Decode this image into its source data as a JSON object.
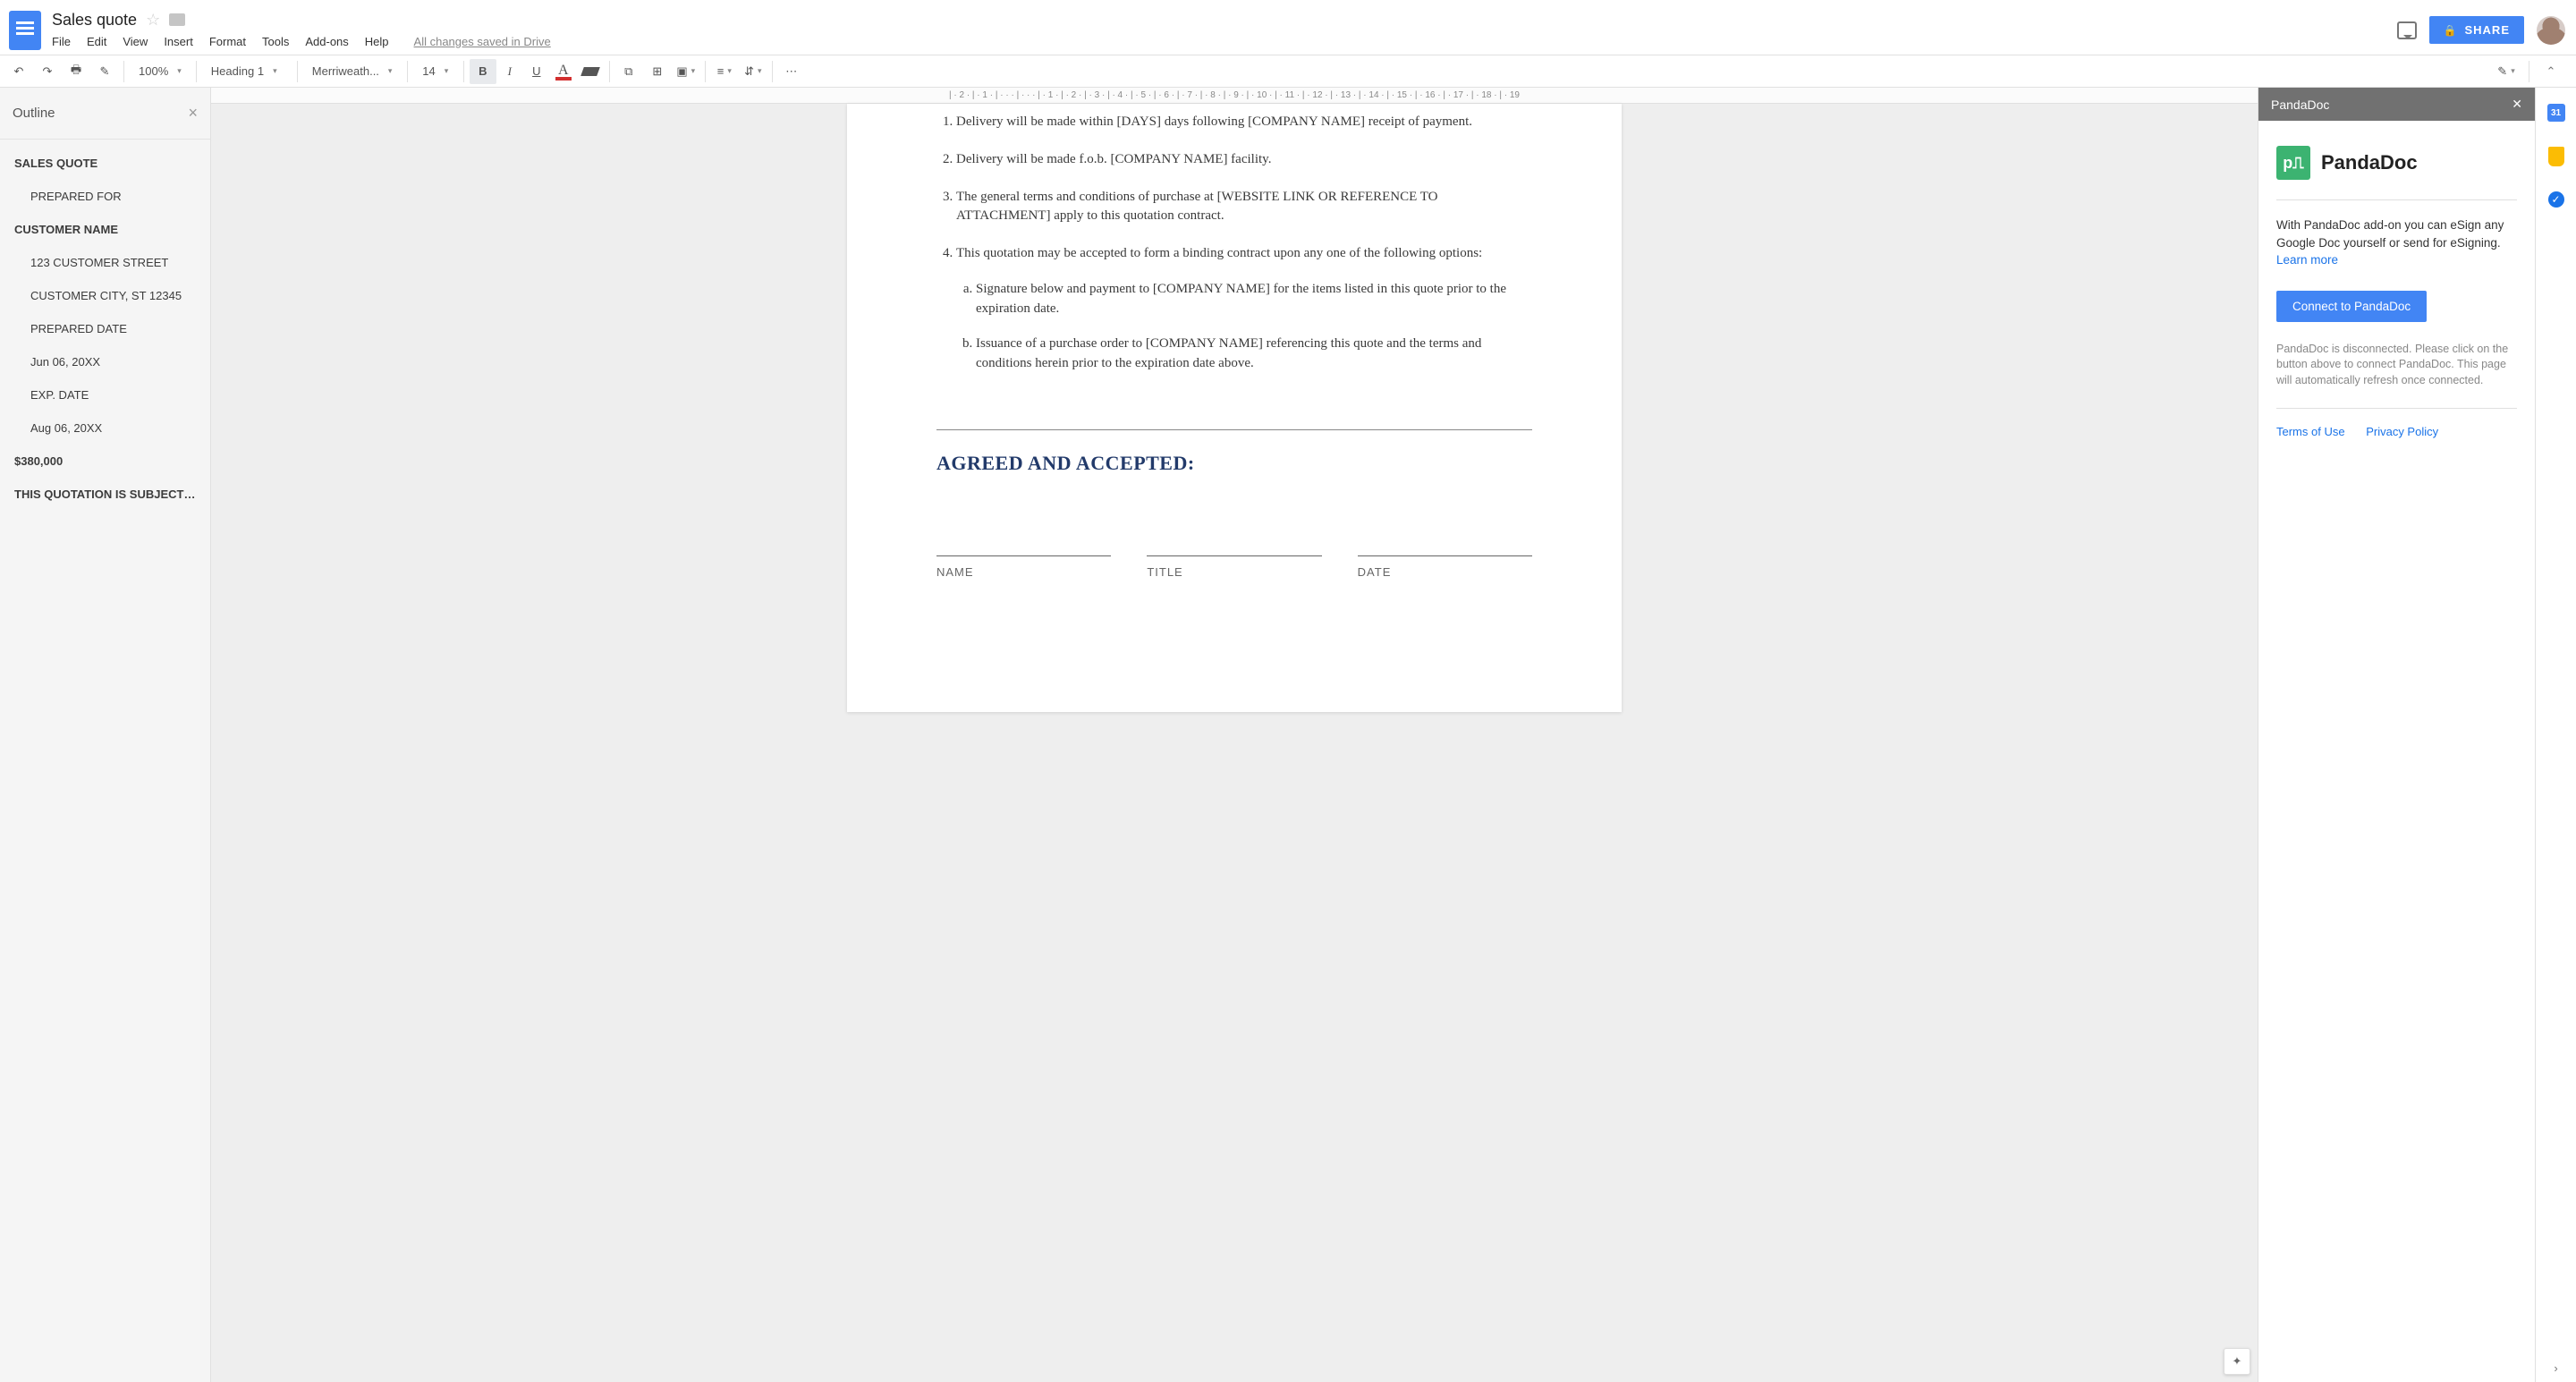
{
  "header": {
    "title": "Sales quote",
    "menus": [
      "File",
      "Edit",
      "View",
      "Insert",
      "Format",
      "Tools",
      "Add-ons",
      "Help"
    ],
    "saved_text": "All changes saved in Drive",
    "share_label": "SHARE"
  },
  "toolbar": {
    "zoom": "100%",
    "style": "Heading 1",
    "font": "Merriweath...",
    "size": "14"
  },
  "ruler": "| · 2 · | · 1 · | · · · | · · · | · 1 · | · 2 · | · 3 · | · 4 · | · 5 · | · 6 · | · 7 · | · 8 · | · 9 · | · 10 · | · 11 · | · 12 · | · 13 · | · 14 · | · 15 · | · 16 · | · 17 · | · 18 · | · 19",
  "outline": {
    "title": "Outline",
    "items": [
      {
        "text": "SALES QUOTE",
        "lvl": 0
      },
      {
        "text": "PREPARED FOR",
        "lvl": 1
      },
      {
        "text": "CUSTOMER NAME",
        "lvl": 0
      },
      {
        "text": "123 CUSTOMER STREET",
        "lvl": 1
      },
      {
        "text": "CUSTOMER CITY, ST 12345",
        "lvl": 1
      },
      {
        "text": "PREPARED DATE",
        "lvl": 1
      },
      {
        "text": "Jun 06, 20XX",
        "lvl": 1
      },
      {
        "text": "EXP. DATE",
        "lvl": 1
      },
      {
        "text": "Aug 06, 20XX",
        "lvl": 1
      },
      {
        "text": "$380,000",
        "lvl": 0
      },
      {
        "text": "THIS QUOTATION IS SUBJECT…",
        "lvl": 0
      }
    ]
  },
  "document": {
    "list": [
      "Delivery will be made within [DAYS] days following [COMPANY NAME] receipt of payment.",
      "Delivery will be made f.o.b. [COMPANY NAME] facility.",
      "The general terms and conditions of purchase at [WEBSITE LINK OR REFERENCE TO ATTACHMENT] apply to this quotation contract.",
      "This quotation may be accepted to form a binding contract upon any one of the following options:"
    ],
    "sublist": [
      "Signature below and payment to [COMPANY NAME] for the items listed in this quote prior to the expiration date.",
      "Issuance of a purchase order to [COMPANY NAME] referencing this quote and the terms and conditions herein prior to the expiration date above."
    ],
    "agreed_heading": "AGREED AND ACCEPTED:",
    "sig_labels": [
      "NAME",
      "TITLE",
      "DATE"
    ]
  },
  "pandadoc": {
    "title": "PandaDoc",
    "brand_text": "PandaDoc",
    "description": "With PandaDoc add-on you can eSign any Google Doc yourself or send for eSigning.",
    "learn_more": "Learn more",
    "connect_btn": "Connect to PandaDoc",
    "status": "PandaDoc is disconnected. Please click on the button above to connect PandaDoc. This page will automatically refresh once connected.",
    "footer_links": [
      "Terms of Use",
      "Privacy Policy"
    ]
  },
  "siderail": {
    "cal": "31"
  }
}
